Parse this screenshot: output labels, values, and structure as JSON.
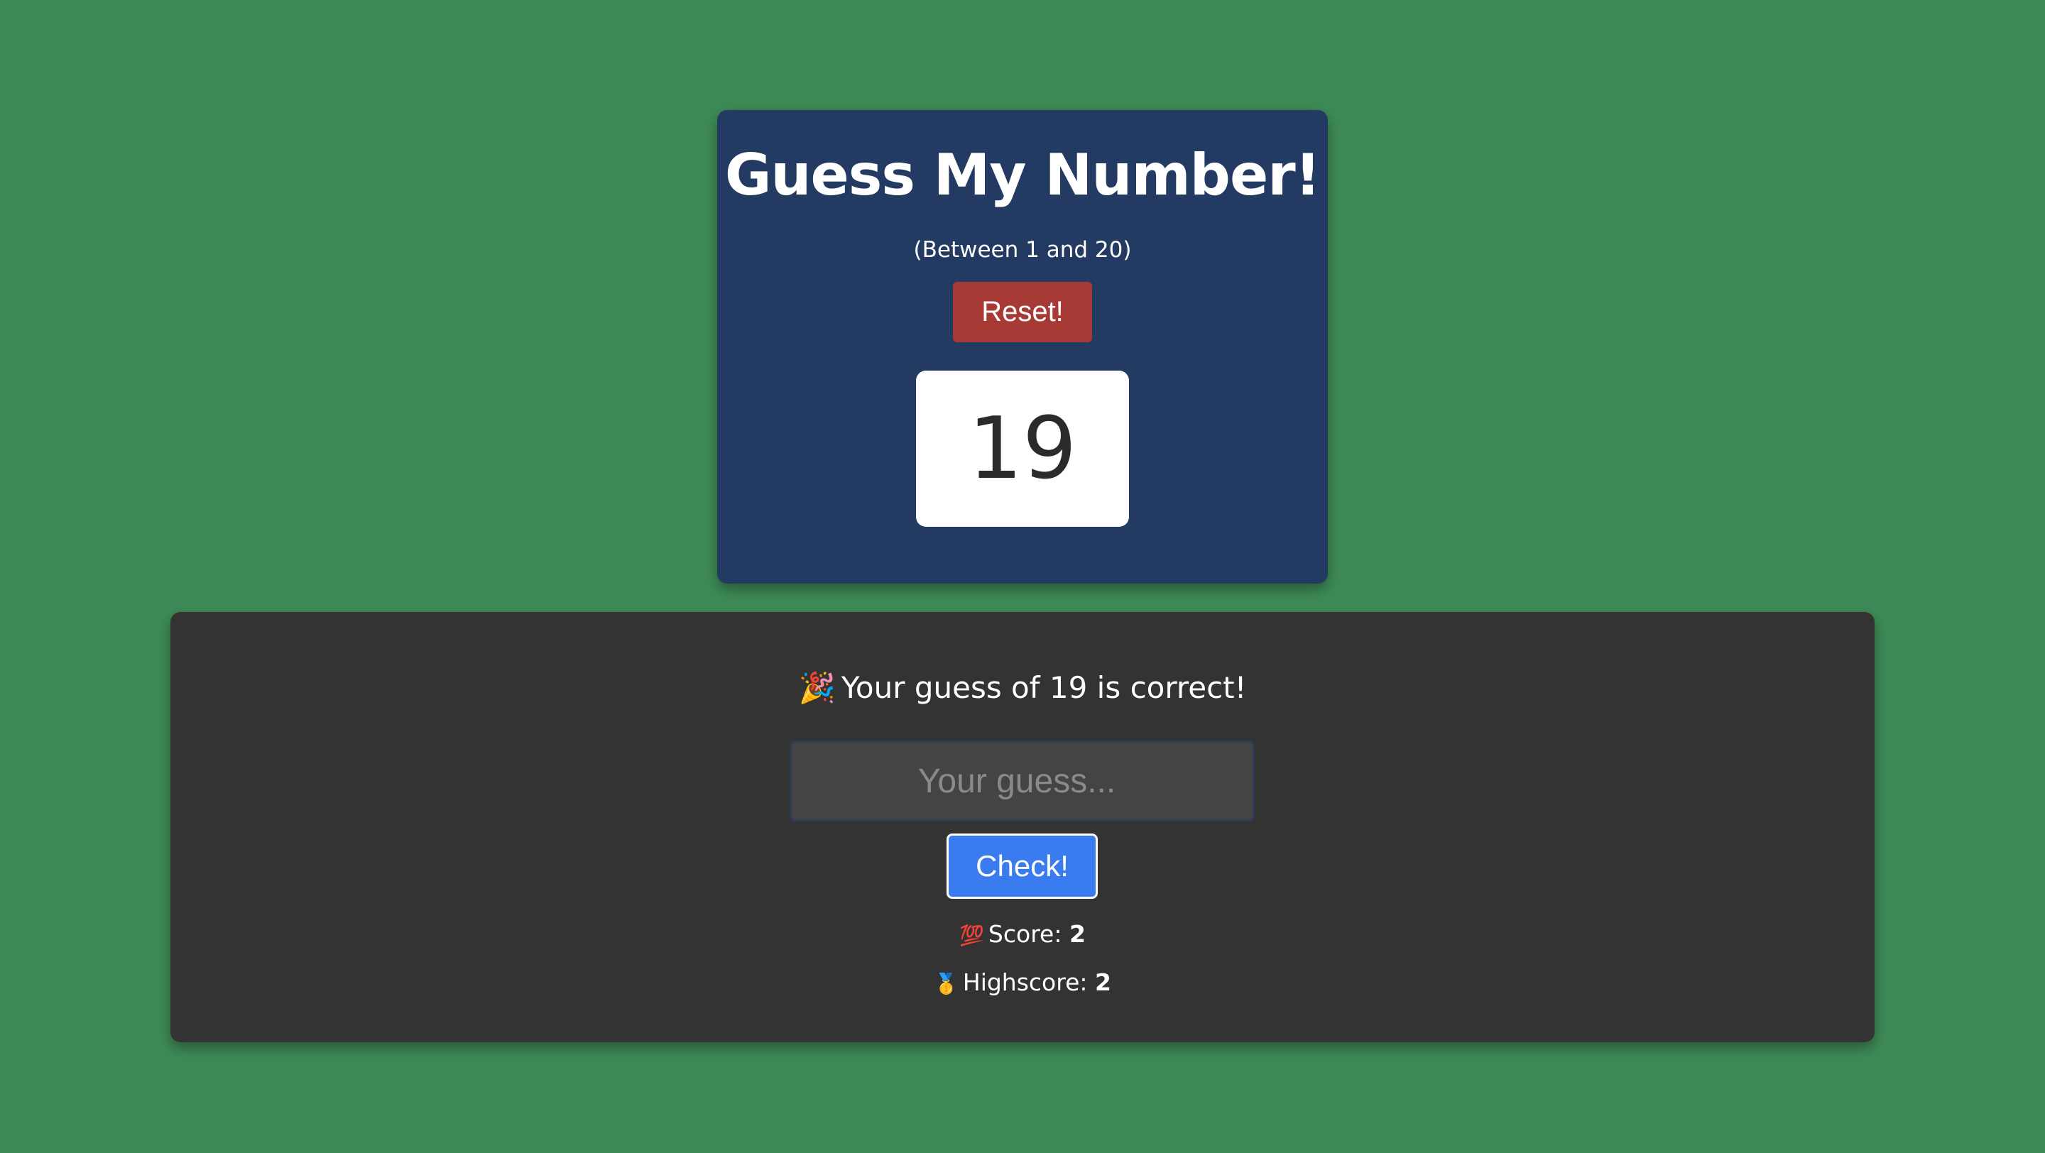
{
  "header": {
    "title": "Guess My Number!",
    "subtitle": "(Between 1 and 20)",
    "reset_label": "Reset!",
    "secret_number": "19"
  },
  "game": {
    "message_icon": "🎉",
    "message": "Your guess of 19 is correct!",
    "guess_placeholder": "Your guess...",
    "guess_value": "",
    "check_label": "Check!",
    "score_icon": "💯",
    "score_label": "Score:",
    "score_value": "2",
    "highscore_icon": "🥇",
    "highscore_label": "Highscore:",
    "highscore_value": "2"
  },
  "colors": {
    "background": "#3e8a56",
    "header_card": "#233a63",
    "reset_button": "#a83a36",
    "panel": "#333333",
    "check_button": "#3a7bf0"
  }
}
